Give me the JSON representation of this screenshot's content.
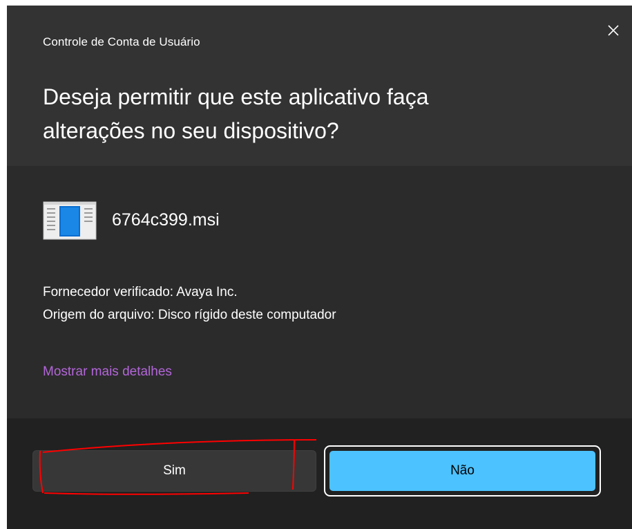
{
  "dialog": {
    "window_title": "Controle de Conta de Usuário",
    "close_icon": "close-icon",
    "headline_line1": "Deseja permitir que este aplicativo faça",
    "headline_line2": "alterações no seu dispositivo?",
    "app": {
      "icon": "installer-icon",
      "name": "6764c399.msi"
    },
    "publisher": "Fornecedor verificado: Avaya Inc.",
    "origin": "Origem do arquivo: Disco rígido deste computador",
    "more_details_link": "Mostrar mais detalhes",
    "buttons": {
      "yes": "Sim",
      "no": "Não"
    }
  },
  "colors": {
    "dialog_background": "#2b2b2b",
    "header_background": "#333333",
    "footer_background": "#212121",
    "link": "#b366d9",
    "primary_button": "#4cc2ff",
    "annotation_marker": "#ff0000"
  }
}
